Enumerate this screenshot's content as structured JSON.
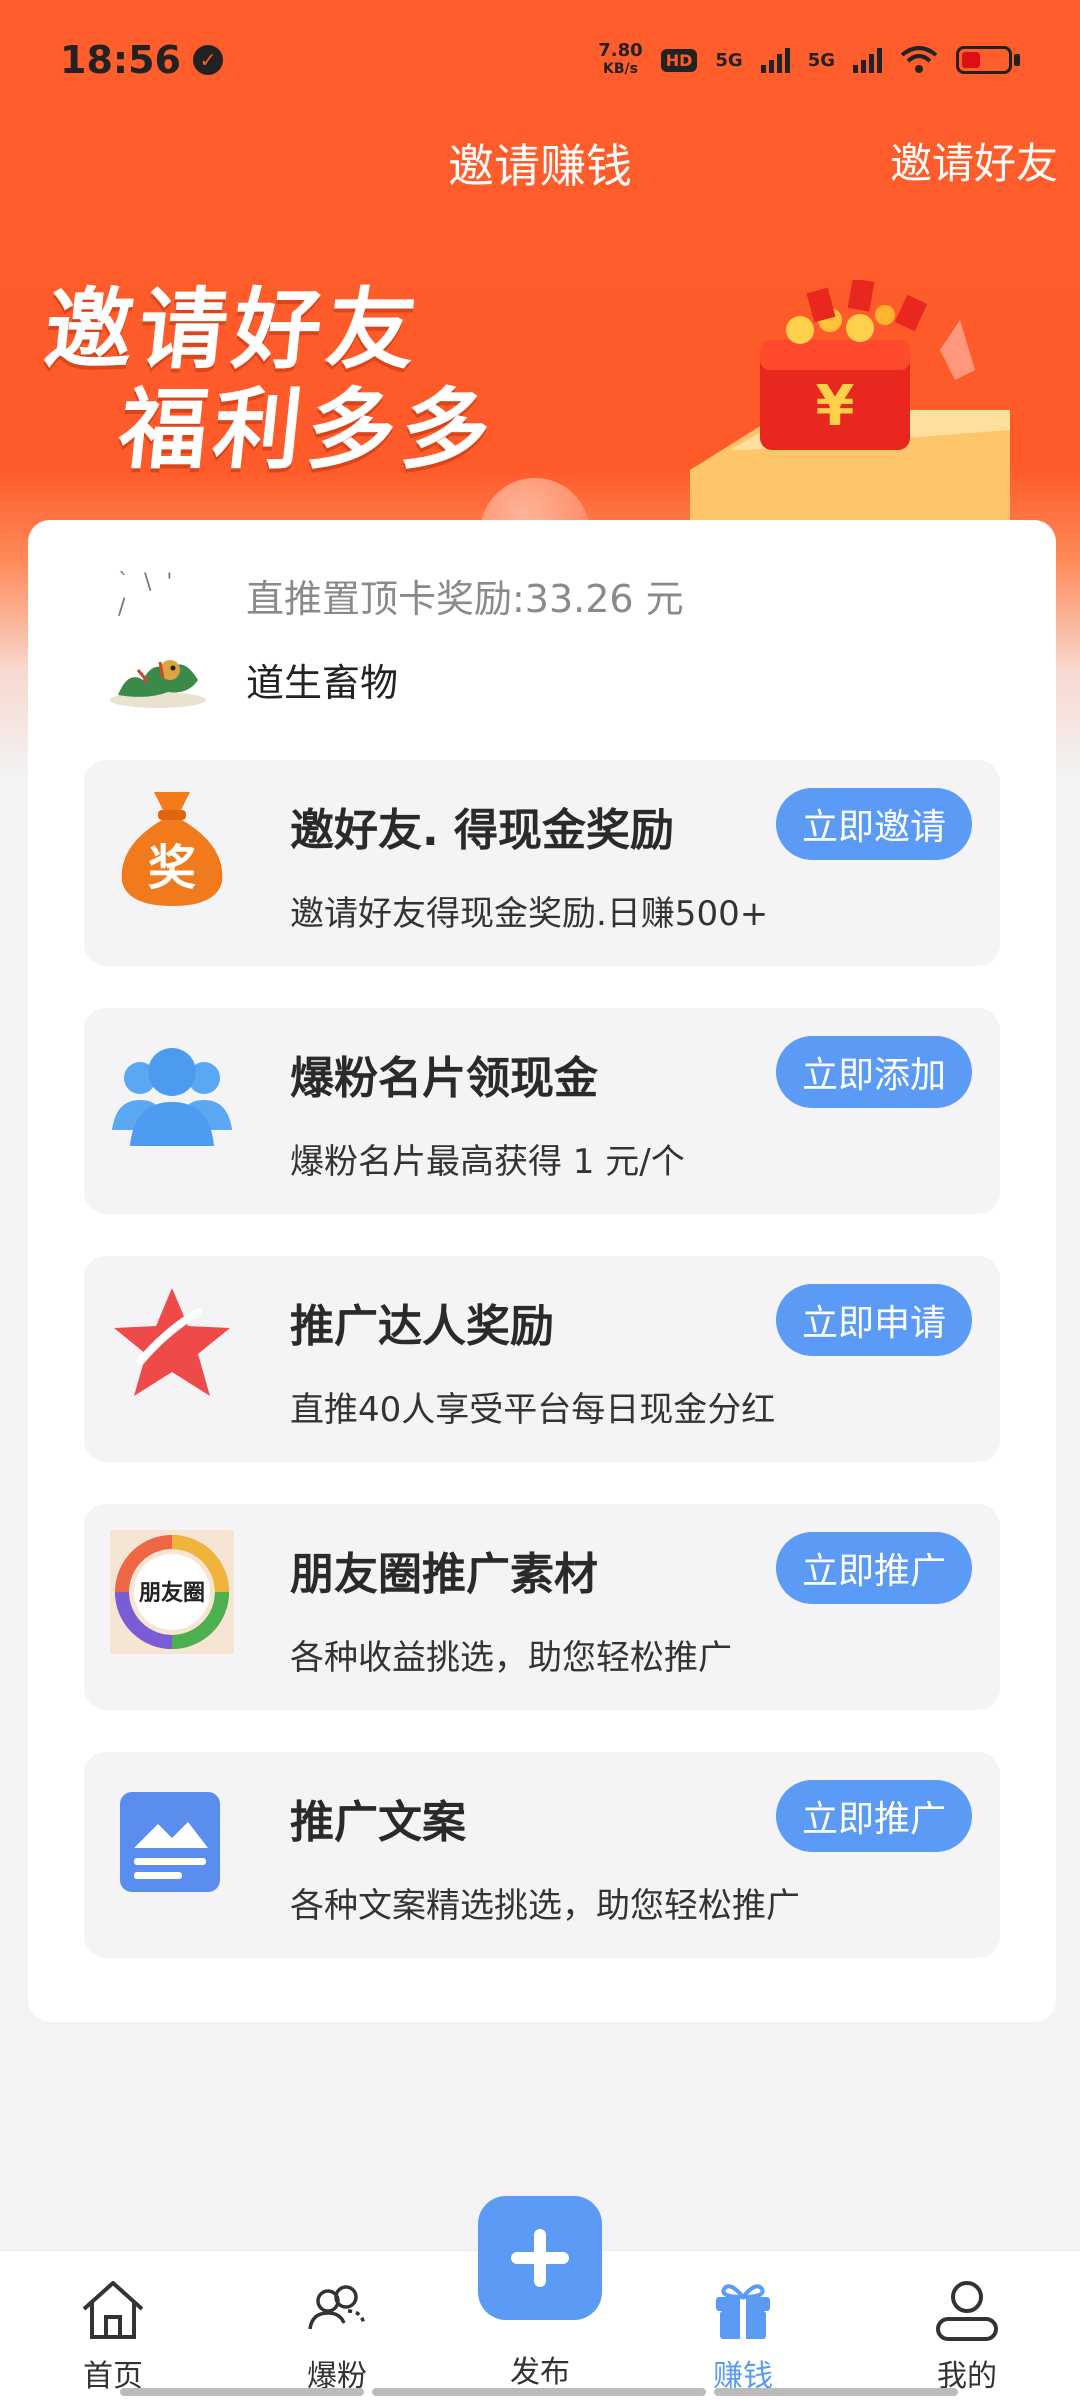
{
  "status_bar": {
    "time": "18:56",
    "net_speed_value": "7.80",
    "net_speed_unit": "KB/s",
    "hd_label": "HD",
    "sim1": "5G",
    "sim2": "5G"
  },
  "nav": {
    "title": "邀请赚钱",
    "right_action": "邀请好友"
  },
  "banner": {
    "line1": "邀请好友",
    "line2": "福利多多",
    "gift_symbol": "¥"
  },
  "marquee": {
    "row1": "直推置顶卡奖励:33.26 元",
    "row2": "道生畜物"
  },
  "tasks": [
    {
      "title": "邀好友. 得现金奖励",
      "desc": "邀请好友得现金奖励.日赚500+",
      "button": "立即邀请",
      "icon": "money-bag-icon",
      "icon_text": "奖"
    },
    {
      "title": "爆粉名片领现金",
      "desc": "爆粉名片最高获得 1 元/个",
      "button": "立即添加",
      "icon": "users-icon"
    },
    {
      "title": "推广达人奖励",
      "desc": "直推40人享受平台每日现金分红",
      "button": "立即申请",
      "icon": "star-icon"
    },
    {
      "title": "朋友圈推广素材",
      "desc": "各种收益挑选，助您轻松推广",
      "button": "立即推广",
      "icon": "moments-icon",
      "icon_text": "朋友圈"
    },
    {
      "title": "推广文案",
      "desc": "各种文案精选挑选，助您轻松推广",
      "button": "立即推广",
      "icon": "document-icon"
    }
  ],
  "tabbar": {
    "items": [
      {
        "label": "首页",
        "icon": "home-icon"
      },
      {
        "label": "爆粉",
        "icon": "fans-icon"
      },
      {
        "label": "发布",
        "icon": "plus-icon"
      },
      {
        "label": "赚钱",
        "icon": "gift-icon",
        "active": true
      },
      {
        "label": "我的",
        "icon": "profile-icon"
      }
    ]
  },
  "colors": {
    "brand_orange": "#ff5e2c",
    "accent_blue": "#5b9bf5",
    "card_bg": "#f4f4f6"
  }
}
